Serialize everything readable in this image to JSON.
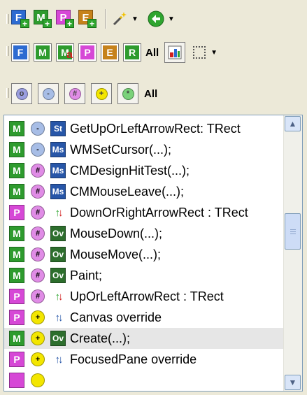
{
  "toolbar_new": {
    "items": [
      {
        "letter": "F",
        "color": "#2d6bd1",
        "name": "new-field-button"
      },
      {
        "letter": "M",
        "color": "#2e9b2e",
        "name": "new-method-button"
      },
      {
        "letter": "P",
        "color": "#d648d6",
        "name": "new-property-button"
      },
      {
        "letter": "E",
        "color": "#c6821b",
        "name": "new-event-button"
      }
    ],
    "wand_icon": "magic-wand-icon",
    "back_icon": "green-back-arrow-icon"
  },
  "filters": {
    "kinds": [
      {
        "letter": "F",
        "color": "#2d6bd1"
      },
      {
        "letter": "M",
        "color": "#2e9b2e"
      },
      {
        "letter": "M",
        "color": "#2e9b2e",
        "badge": "a"
      },
      {
        "letter": "P",
        "color": "#d648d6"
      },
      {
        "letter": "E",
        "color": "#c6821b"
      },
      {
        "letter": "R",
        "color": "#2e9b2e"
      }
    ],
    "all_label": "All"
  },
  "visibility": {
    "items": [
      {
        "name": "private",
        "color": "#9a9ee0",
        "glyph": "o"
      },
      {
        "name": "strict-private",
        "color": "#a7bde6",
        "glyph": "-"
      },
      {
        "name": "protected",
        "color": "#e08ce6",
        "glyph": "#"
      },
      {
        "name": "public",
        "color": "#f3e600",
        "glyph": "+"
      },
      {
        "name": "published",
        "color": "#7ad27a",
        "glyph": "*"
      }
    ],
    "all_label": "All"
  },
  "members": [
    {
      "kind": "M",
      "vis": "-",
      "type": "St",
      "text": "GetUpOrLeftArrowRect: TRect"
    },
    {
      "kind": "M",
      "vis": "-",
      "type": "Ms",
      "text": "WMSetCursor(...);"
    },
    {
      "kind": "M",
      "vis": "#",
      "type": "Ms",
      "text": "CMDesignHitTest(...);"
    },
    {
      "kind": "M",
      "vis": "#",
      "type": "Ms",
      "text": "CMMouseLeave(...);"
    },
    {
      "kind": "P",
      "vis": "#",
      "type": "rw",
      "text": "DownOrRightArrowRect : TRect"
    },
    {
      "kind": "M",
      "vis": "#",
      "type": "Ov",
      "text": "MouseDown(...);"
    },
    {
      "kind": "M",
      "vis": "#",
      "type": "Ov",
      "text": "MouseMove(...);"
    },
    {
      "kind": "M",
      "vis": "#",
      "type": "Ov",
      "text": "Paint;"
    },
    {
      "kind": "P",
      "vis": "#",
      "type": "rw",
      "text": "UpOrLeftArrowRect : TRect"
    },
    {
      "kind": "P",
      "vis": "+",
      "type": "ud",
      "text": "Canvas override"
    },
    {
      "kind": "M",
      "vis": "+",
      "type": "Ov",
      "text": "Create(...);",
      "selected": true
    },
    {
      "kind": "P",
      "vis": "+",
      "type": "ud",
      "text": "FocusedPane override"
    }
  ],
  "colors": {
    "method": "#2e9b2e",
    "property": "#d648d6",
    "static": "#2756a8",
    "message": "#2756a8",
    "override": "#2d6e2d",
    "strict_private": "#a7bde6",
    "protected": "#e08ce6",
    "public": "#f3e600"
  }
}
